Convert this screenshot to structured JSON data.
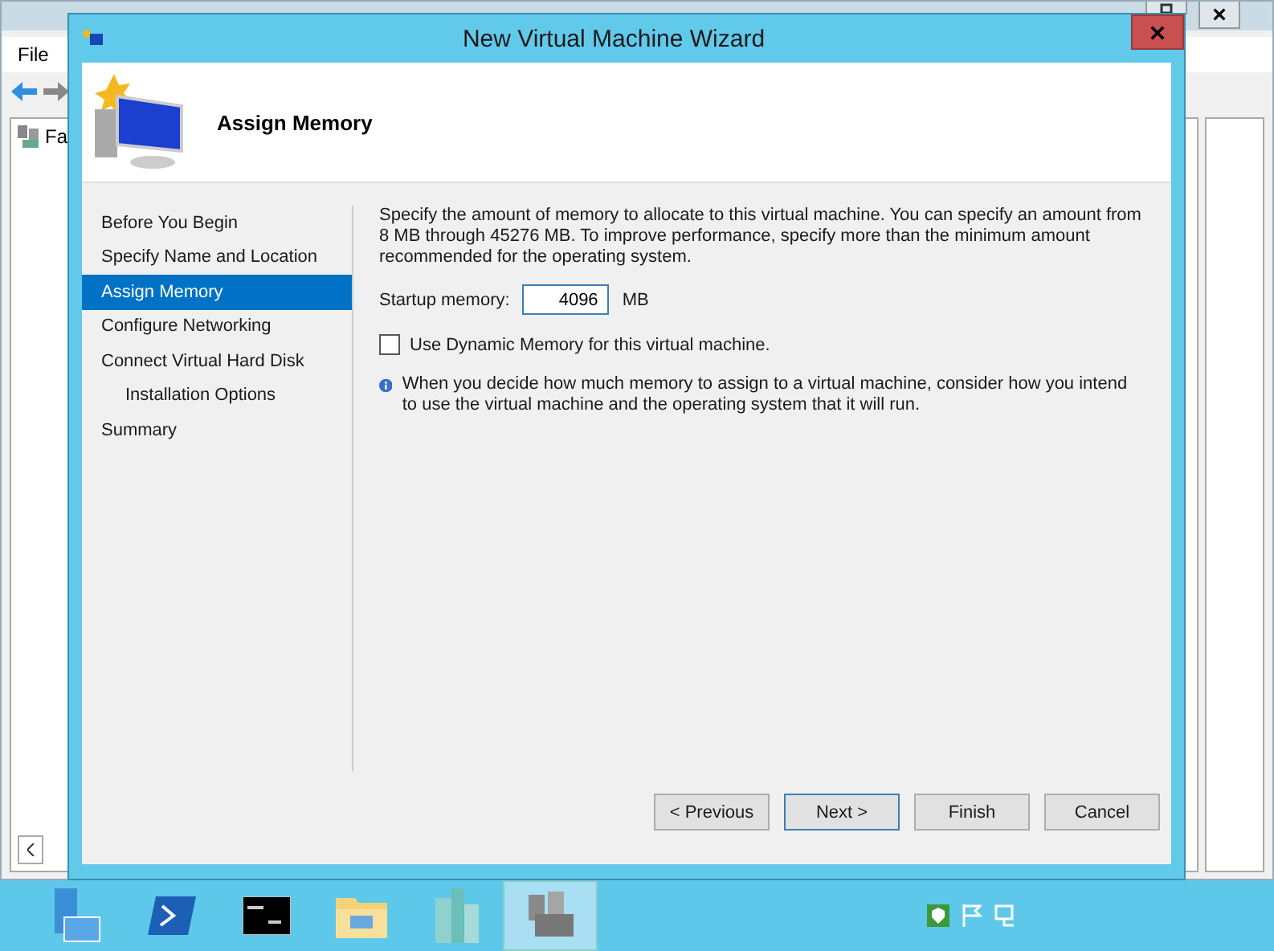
{
  "background_window": {
    "menu": [
      "File"
    ],
    "tree_items": [
      "Fa"
    ]
  },
  "wizard": {
    "title": "New Virtual Machine Wizard",
    "heading": "Assign Memory",
    "steps": [
      {
        "label": "Before You Begin",
        "selected": false
      },
      {
        "label": "Specify Name and Location",
        "selected": false
      },
      {
        "label": "Assign Memory",
        "selected": true
      },
      {
        "label": "Configure Networking",
        "selected": false
      },
      {
        "label": "Connect Virtual Hard Disk",
        "selected": false,
        "children": [
          {
            "label": "Installation Options",
            "selected": false
          }
        ]
      },
      {
        "label": "Summary",
        "selected": false
      }
    ],
    "description": "Specify the amount of memory to allocate to this virtual machine. You can specify an amount from 8 MB through 45276 MB. To improve performance, specify more than the minimum amount recommended for the operating system.",
    "startup_memory": {
      "label": "Startup memory:",
      "value": "4096",
      "unit": "MB"
    },
    "dynamic_memory": {
      "label": "Use Dynamic Memory for this virtual machine.",
      "checked": false
    },
    "info": "When you decide how much memory to assign to a virtual machine, consider how you intend to use the virtual machine and the operating system that it will run.",
    "buttons": [
      "< Previous",
      "Next >",
      "Finish",
      "Cancel"
    ]
  },
  "taskbar": {
    "apps": [
      {
        "kind": "server",
        "selected": false
      },
      {
        "kind": "powershell",
        "selected": false
      },
      {
        "kind": "cmd",
        "selected": false
      },
      {
        "kind": "folder",
        "selected": false
      },
      {
        "kind": "buildings",
        "selected": false
      },
      {
        "kind": "cluster",
        "selected": true
      }
    ]
  }
}
